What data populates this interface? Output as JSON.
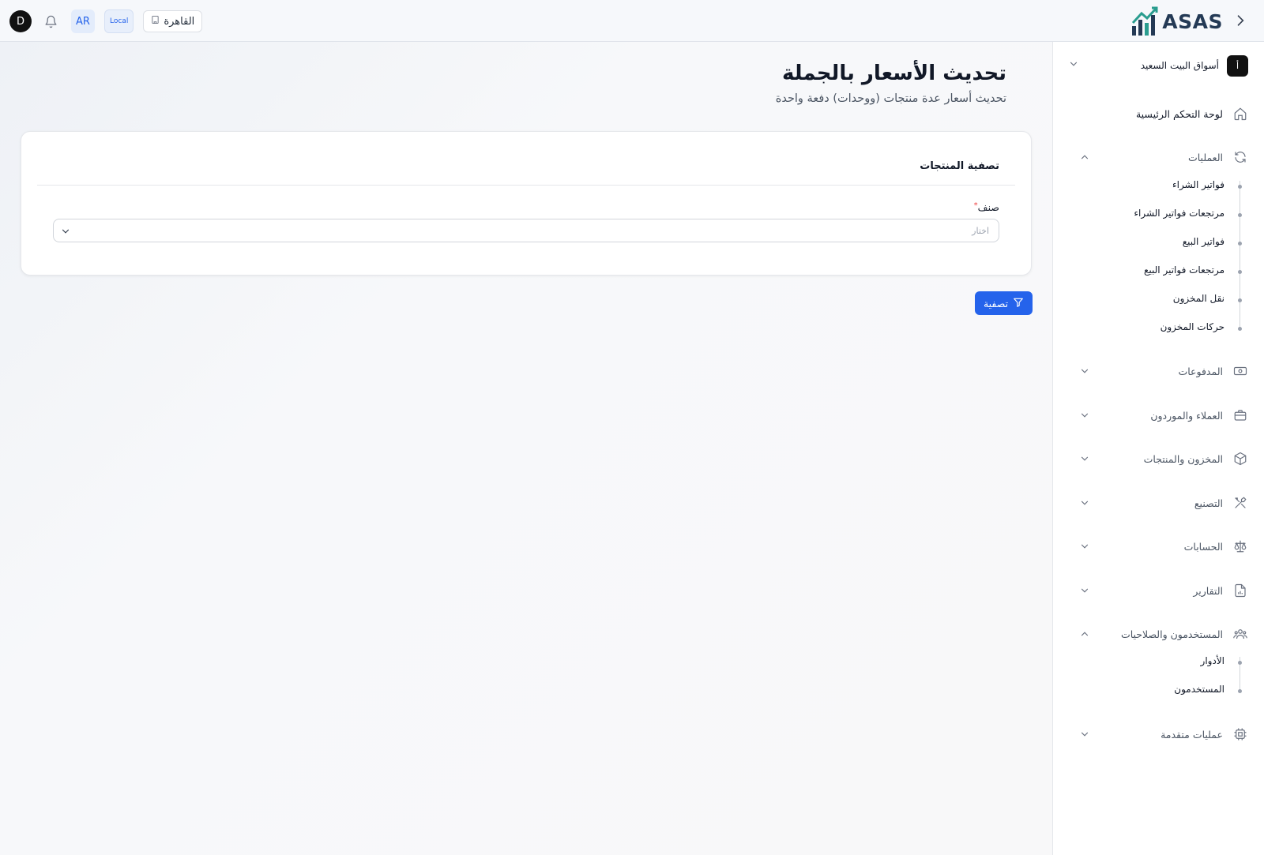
{
  "header": {
    "avatar_initial": "D",
    "language": "AR",
    "env_badge": "Local",
    "branch": "القاهرة",
    "logo_text": "ASAS"
  },
  "sidebar": {
    "store_icon_text": "أ",
    "store_name": "أسواق البيت السعيد",
    "items": [
      {
        "label": "لوحة التحكم الرئيسية",
        "icon": "home-icon"
      },
      {
        "label": "العمليات",
        "icon": "refresh-icon",
        "expanded": true,
        "children": [
          "فواتير الشراء",
          "مرتجعات فواتير الشراء",
          "فواتير البيع",
          "مرتجعات فواتير البيع",
          "نقل المخزون",
          "حركات المخزون"
        ]
      },
      {
        "label": "المدفوعات",
        "icon": "cash-icon"
      },
      {
        "label": "العملاء والموردون",
        "icon": "briefcase-icon"
      },
      {
        "label": "المخزون والمنتجات",
        "icon": "box-icon"
      },
      {
        "label": "التصنيع",
        "icon": "tools-icon"
      },
      {
        "label": "الحسابات",
        "icon": "scale-icon"
      },
      {
        "label": "التقارير",
        "icon": "report-icon"
      },
      {
        "label": "المستخدمون والصلاحيات",
        "icon": "users-icon",
        "expanded": true,
        "children": [
          "الأدوار",
          "المستخدمون"
        ]
      },
      {
        "label": "عمليات متقدمة",
        "icon": "chip-icon"
      }
    ]
  },
  "main": {
    "title": "تحديث الأسعار بالجملة",
    "subtitle": "تحديث أسعار عدة منتجات (ووحدات) دفعة واحدة",
    "card_title": "تصفية المنتجات",
    "field_label": "صنف",
    "field_required": "*",
    "select_placeholder": "اختار",
    "filter_button": "تصفية"
  },
  "colors": {
    "accent": "#2563eb",
    "sidebar_bg": "#ffffff",
    "topbar_bg": "#f6f8fb"
  }
}
